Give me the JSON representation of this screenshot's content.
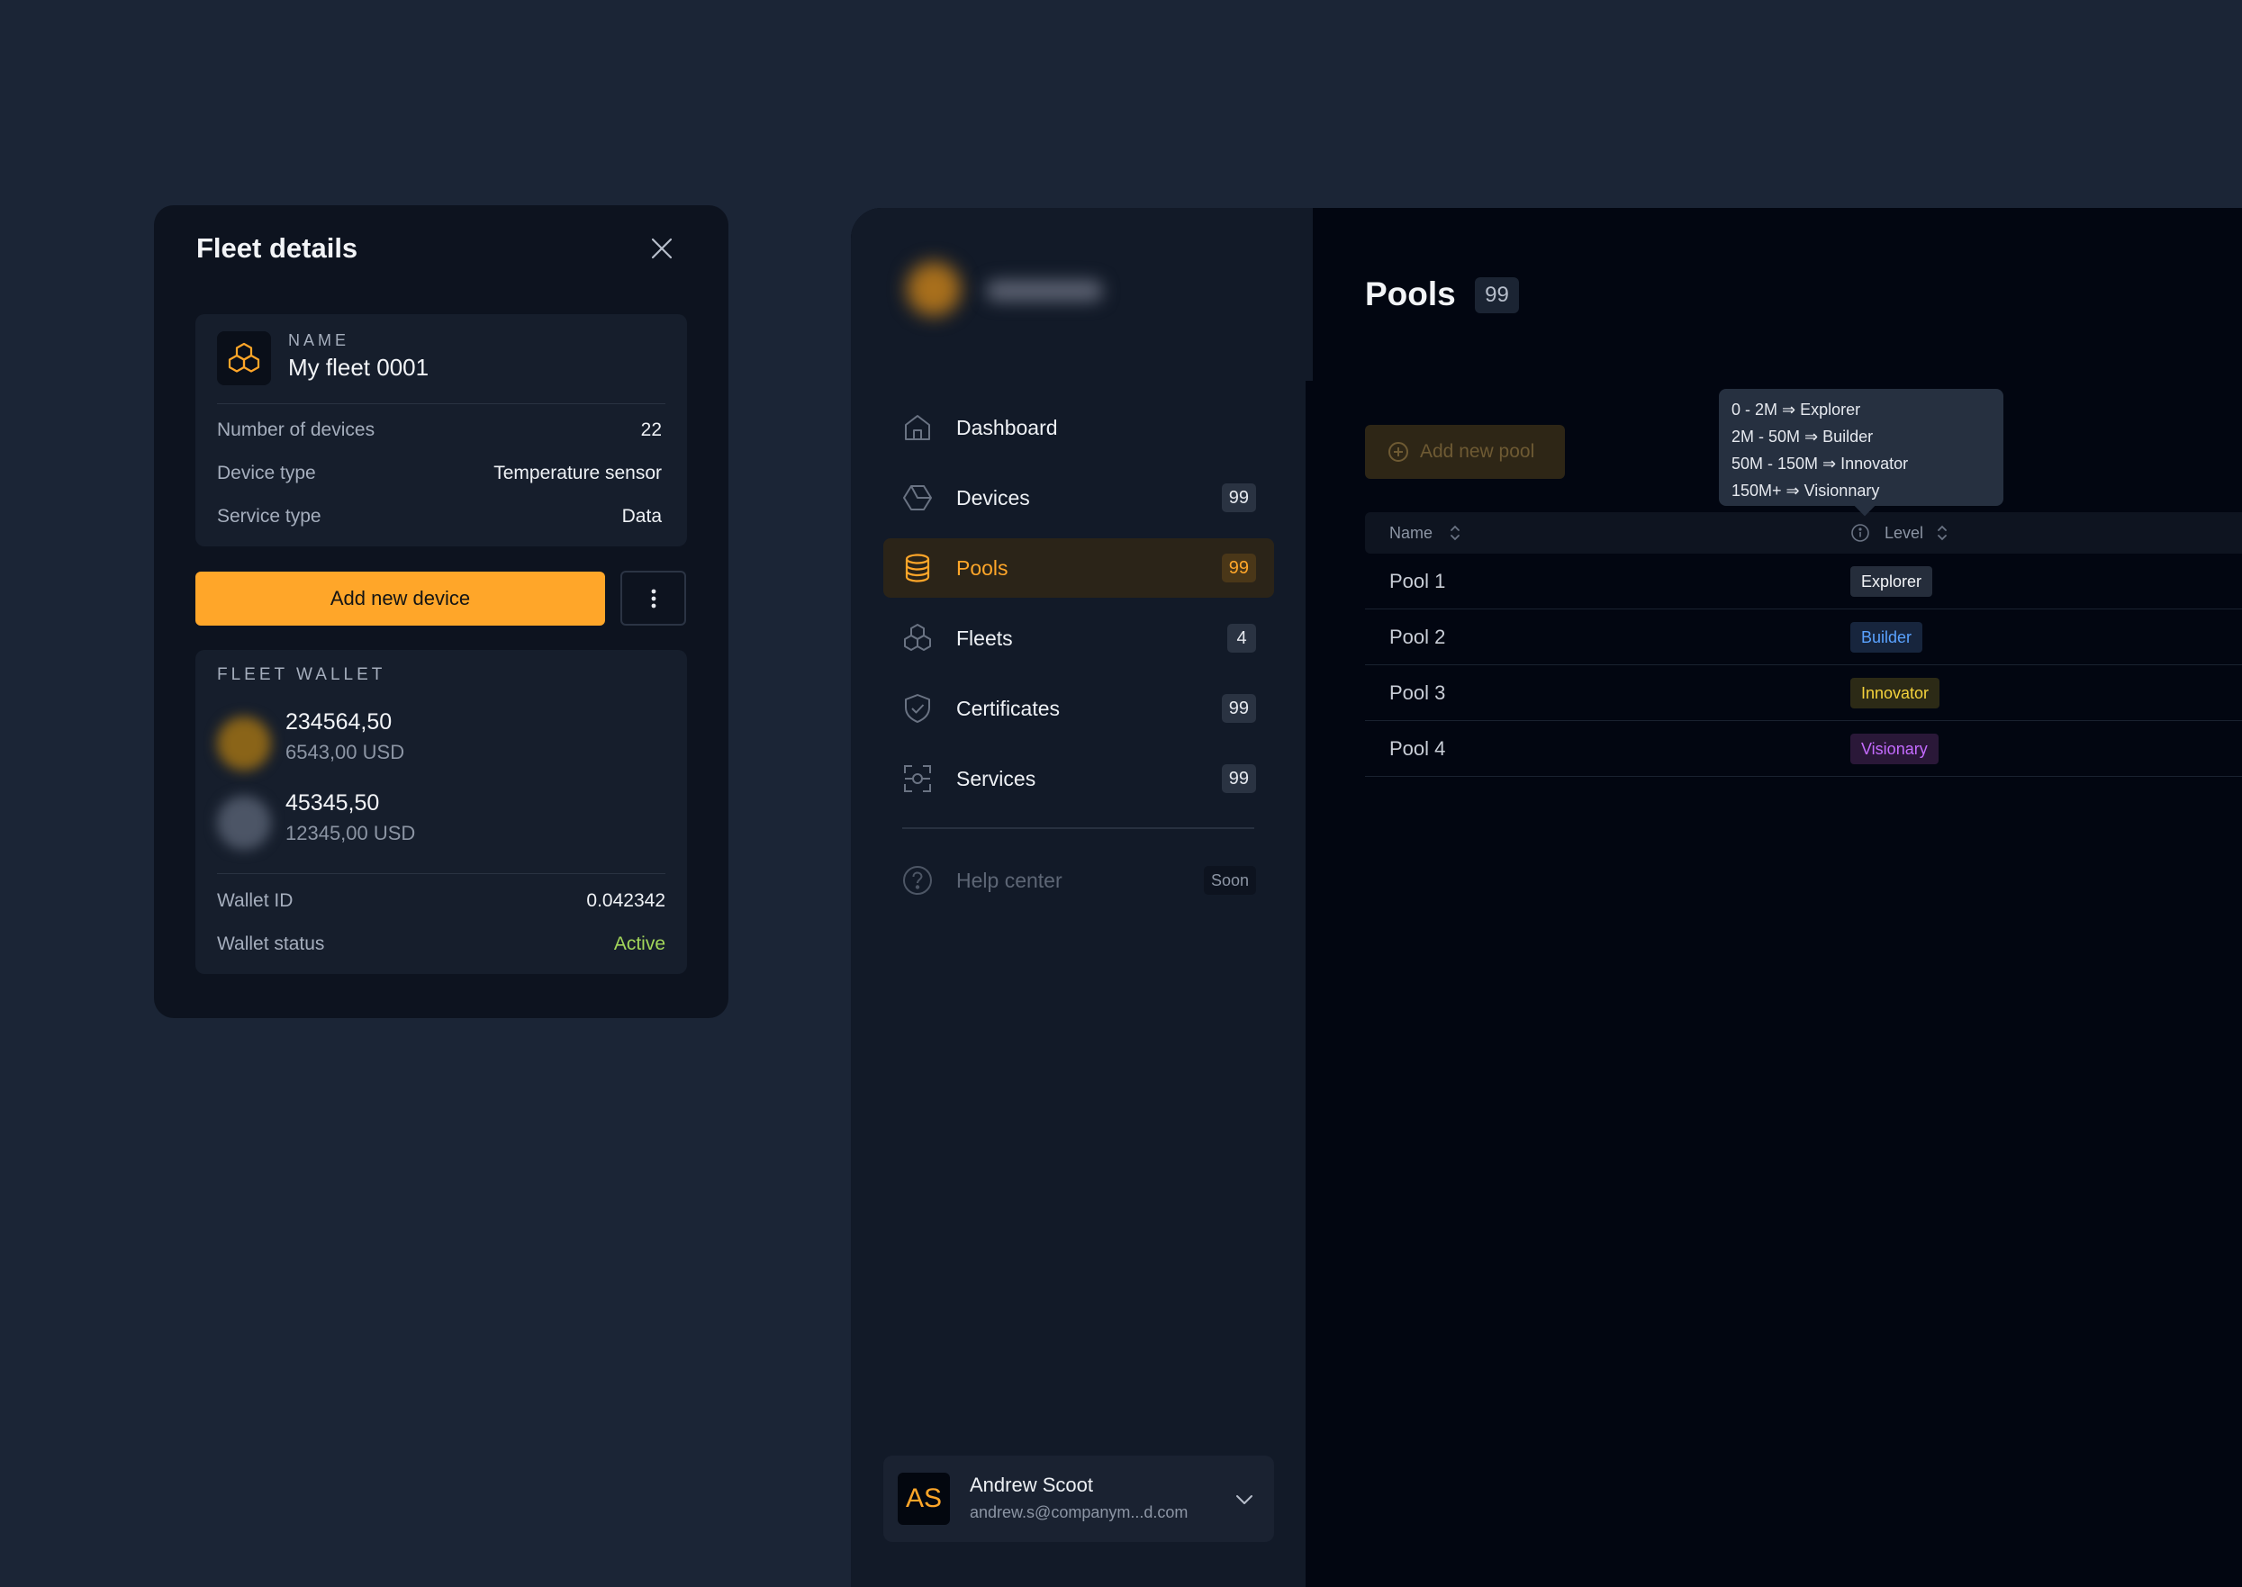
{
  "fleet_details": {
    "title": "Fleet details",
    "name_label": "NAME",
    "name_value": "My fleet 0001",
    "rows": [
      {
        "label": "Number of devices",
        "value": "22"
      },
      {
        "label": "Device type",
        "value": "Temperature sensor"
      },
      {
        "label": "Service type",
        "value": "Data"
      }
    ],
    "add_device_label": "Add new device",
    "wallet": {
      "label": "FLEET WALLET",
      "balances": [
        {
          "amount": "234564,50",
          "usd": "6543,00 USD"
        },
        {
          "amount": "45345,50",
          "usd": "12345,00 USD"
        }
      ],
      "wallet_id_label": "Wallet ID",
      "wallet_id_value": "0.042342",
      "status_label": "Wallet status",
      "status_value": "Active"
    }
  },
  "sidebar": {
    "items": [
      {
        "label": "Dashboard",
        "icon": "home-icon"
      },
      {
        "label": "Devices",
        "badge": "99",
        "icon": "hexagon-icon"
      },
      {
        "label": "Pools",
        "badge": "99",
        "icon": "database-icon",
        "active": true
      },
      {
        "label": "Fleets",
        "badge": "4",
        "icon": "cubes-icon"
      },
      {
        "label": "Certificates",
        "badge": "99",
        "icon": "shield-check-icon"
      },
      {
        "label": "Services",
        "badge": "99",
        "icon": "services-icon"
      }
    ],
    "help": {
      "label": "Help center",
      "badge": "Soon"
    },
    "user": {
      "initials": "AS",
      "name": "Andrew Scoot",
      "email": "andrew.s@companym...d.com"
    }
  },
  "main": {
    "title": "Pools",
    "count": "99",
    "add_pool_label": "Add new pool",
    "columns": {
      "name": "Name",
      "level": "Level"
    },
    "rows": [
      {
        "name": "Pool 1",
        "level": "Explorer"
      },
      {
        "name": "Pool 2",
        "level": "Builder"
      },
      {
        "name": "Pool 3",
        "level": "Innovator"
      },
      {
        "name": "Pool 4",
        "level": "Visionary"
      }
    ],
    "tooltip": [
      "0 - 2M  ⇒ Explorer",
      "2M - 50M  ⇒ Builder",
      "50M - 150M  ⇒ Innovator",
      "150M+ ⇒ Visionnary"
    ]
  },
  "colors": {
    "accent": "#ffa629",
    "active_status": "#a3d65a",
    "explorer": "#f2f4f7",
    "builder": "#5aa2ff",
    "innovator": "#f4d23c",
    "visionary": "#c46bff"
  }
}
